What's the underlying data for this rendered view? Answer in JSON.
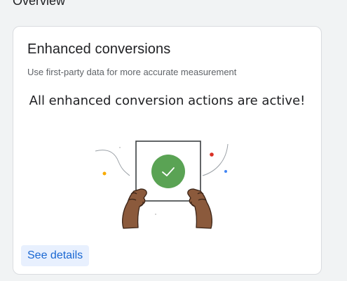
{
  "section": {
    "title": "Overview"
  },
  "card": {
    "title": "Enhanced conversions",
    "subtitle": "Use first-party data for more accurate measurement",
    "status": "All enhanced conversion actions are active!",
    "details_label": "See details"
  },
  "colors": {
    "background": "#f1f3f4",
    "card": "#ffffff",
    "accent_green": "#5aa354",
    "link_blue": "#1967d2",
    "button_bg": "#e8f0fe",
    "skin": "#8b5a3c",
    "dot_red": "#d93025",
    "dot_yellow": "#f9ab00",
    "dot_blue": "#4285f4"
  },
  "illustration": {
    "icon": "hands-holding-checkmark-sign-illustration"
  }
}
